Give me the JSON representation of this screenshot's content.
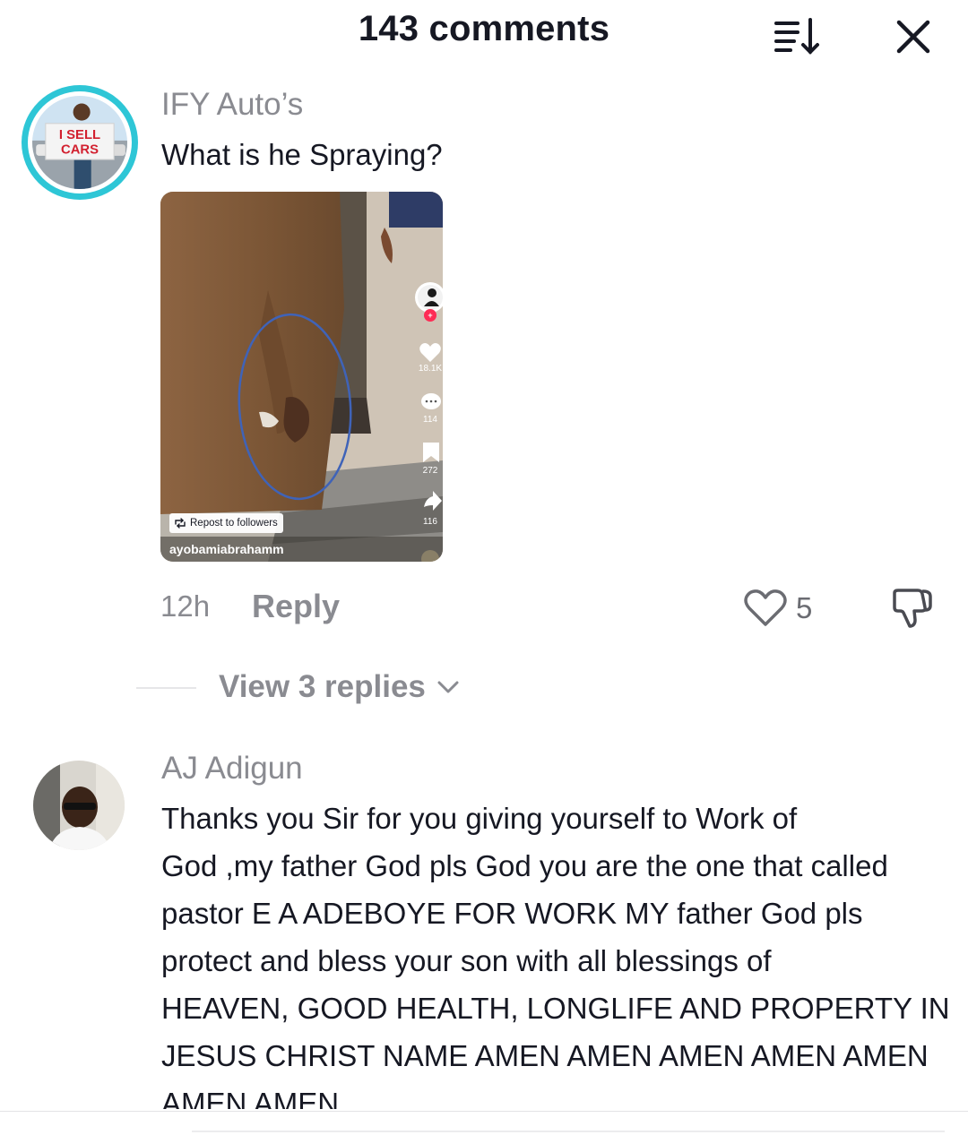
{
  "header": {
    "title": "143 comments",
    "sort_icon": "sort-descending-icon",
    "close_icon": "close-icon"
  },
  "comments": [
    {
      "username": "IFY Auto’s",
      "text": "What is he Spraying?",
      "avatar_sign_text": "I SELL CARS",
      "thumbnail": {
        "repost_label": "Repost to followers",
        "author": "ayobamiabrahamm",
        "like_count": "18.1K",
        "comment_count": "114",
        "save_count": "272",
        "share_count": "116"
      },
      "time": "12h",
      "reply_label": "Reply",
      "likes": "5",
      "view_replies_label": "View 3 replies"
    },
    {
      "username": "AJ Adigun",
      "text_lines": [
        "Thanks you Sir for you giving yourself to Work of",
        "God ,my father God pls God you are the one that called",
        "pastor E A ADEBOYE FOR WORK MY father God pls",
        "protect and bless your son with all blessings of",
        "HEAVEN, GOOD HEALTH, LONGLIFE AND PROPERTY IN",
        "JESUS CHRIST NAME AMEN AMEN AMEN AMEN AMEN",
        "AMEN AMEN"
      ]
    }
  ],
  "colors": {
    "primary_text": "#161823",
    "secondary_text": "#8a8b91",
    "avatar_ring": "#2ec6d6",
    "accent_red": "#fe2c55"
  }
}
